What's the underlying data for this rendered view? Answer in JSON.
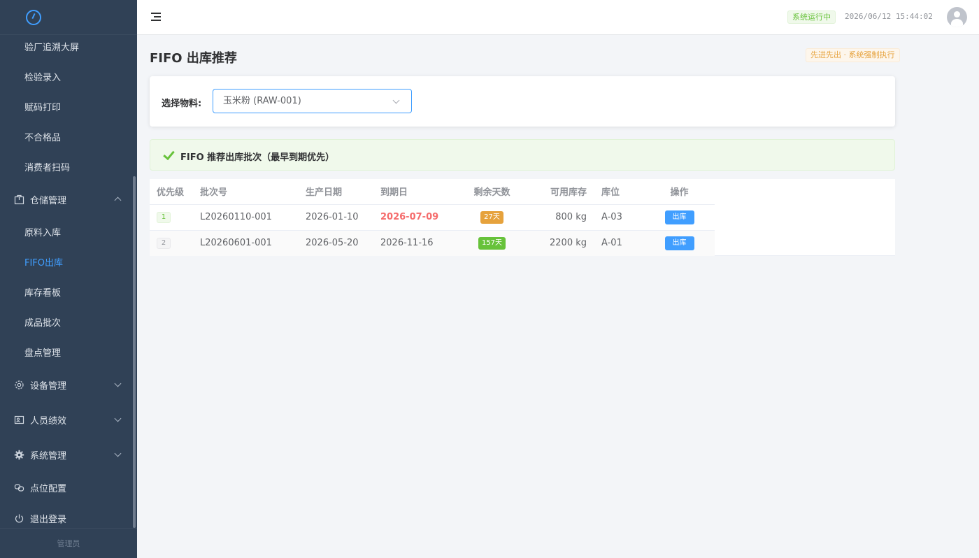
{
  "sidebar": {
    "logo_icon": "gauge-icon",
    "items_top": [
      "验厂追溯大屏",
      "检验录入",
      "赋码打印",
      "不合格品",
      "消费者扫码"
    ],
    "warehouse": {
      "label": "仓储管理",
      "icon": "package-icon",
      "expanded": true
    },
    "warehouse_items": [
      "原料入库",
      "FIFO出库",
      "库存看板",
      "成品批次",
      "盘点管理"
    ],
    "active_item": "FIFO出库",
    "groups": [
      {
        "label": "设备管理",
        "icon": "gear-icon"
      },
      {
        "label": "人员绩效",
        "icon": "user-card-icon"
      },
      {
        "label": "系统管理",
        "icon": "cog-filled-icon"
      }
    ],
    "point_config": {
      "label": "点位配置",
      "icon": "link-icon"
    },
    "logout": {
      "label": "退出登录",
      "icon": "power-icon"
    },
    "footer": "管理员"
  },
  "header": {
    "menu_icon": "hamburger-icon",
    "status": "系统运行中",
    "datetime": "2026/06/12 15:44:02",
    "avatar_icon": "user-avatar-icon"
  },
  "page": {
    "title": "FIFO 出库推荐",
    "rule_tag": "先进先出 · 系统强制执行",
    "select_label": "选择物料:",
    "select_value": "玉米粉 (RAW-001)",
    "alert_text": "FIFO 推荐出库批次（最早到期优先）"
  },
  "table": {
    "headers": [
      "优先级",
      "批次号",
      "生产日期",
      "到期日",
      "剩余天数",
      "可用库存",
      "库位",
      "操作"
    ],
    "rows": [
      {
        "priority": "1",
        "batch": "L20260110-001",
        "produced": "2026-01-10",
        "expires": "2026-07-09",
        "days_left": "27天",
        "stock": "800 kg",
        "location": "A-03",
        "action": "出库"
      },
      {
        "priority": "2",
        "batch": "L20260601-001",
        "produced": "2026-05-20",
        "expires": "2026-11-16",
        "days_left": "157天",
        "stock": "2200 kg",
        "location": "A-01",
        "action": "出库"
      }
    ]
  },
  "colors": {
    "sidebar_bg": "#304156",
    "accent": "#409eff",
    "success": "#67c23a",
    "warning": "#e6a23c",
    "danger": "#f56c6c"
  }
}
